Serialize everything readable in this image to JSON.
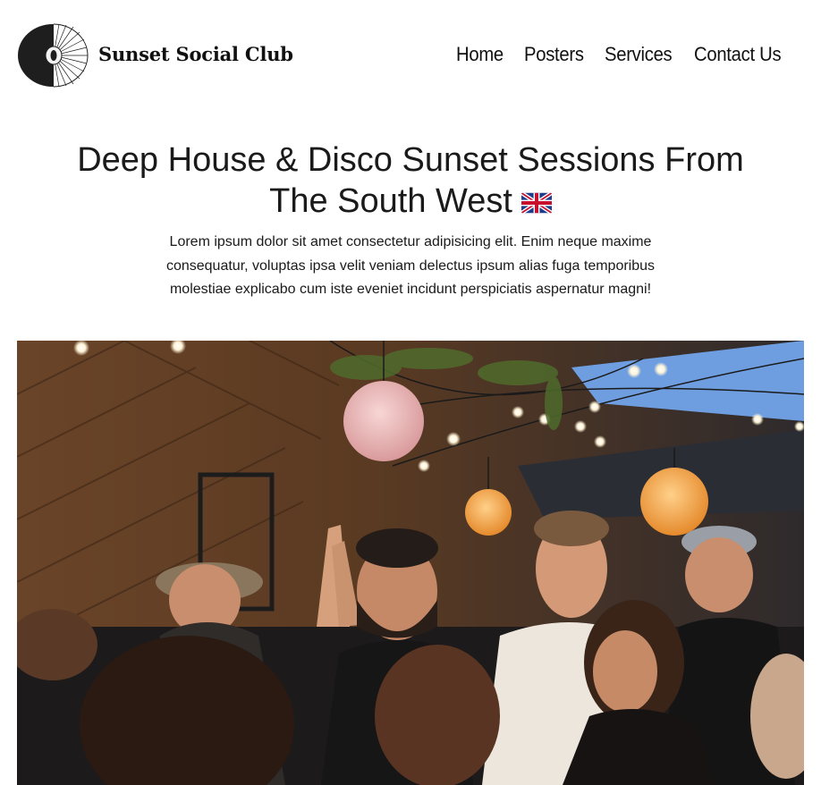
{
  "header": {
    "brand_name": "Sunset Social Club",
    "logo_icon": "sunset-disc-logo-icon"
  },
  "nav": {
    "items": [
      {
        "label": "Home"
      },
      {
        "label": "Posters"
      },
      {
        "label": "Services"
      },
      {
        "label": "Contact Us"
      }
    ]
  },
  "hero": {
    "title_line1": "Deep House & Disco Sunset Sessions From",
    "title_line2": "The South West",
    "flag_icon": "uk-flag-icon",
    "description": "Lorem ipsum dolor sit amet consectetur adipisicing elit. Enim neque maxime consequatur, voluptas ipsa velit veniam delectus ipsum alias fuga temporibus molestiae explicabo cum iste eveniet incidunt perspiciatis aspernatur magni!",
    "image_subject": "party-crowd-photo"
  },
  "colors": {
    "text": "#1a1a1a",
    "background": "#ffffff",
    "lantern_pink": "#e9b3b3",
    "lantern_orange": "#f0a24a"
  }
}
